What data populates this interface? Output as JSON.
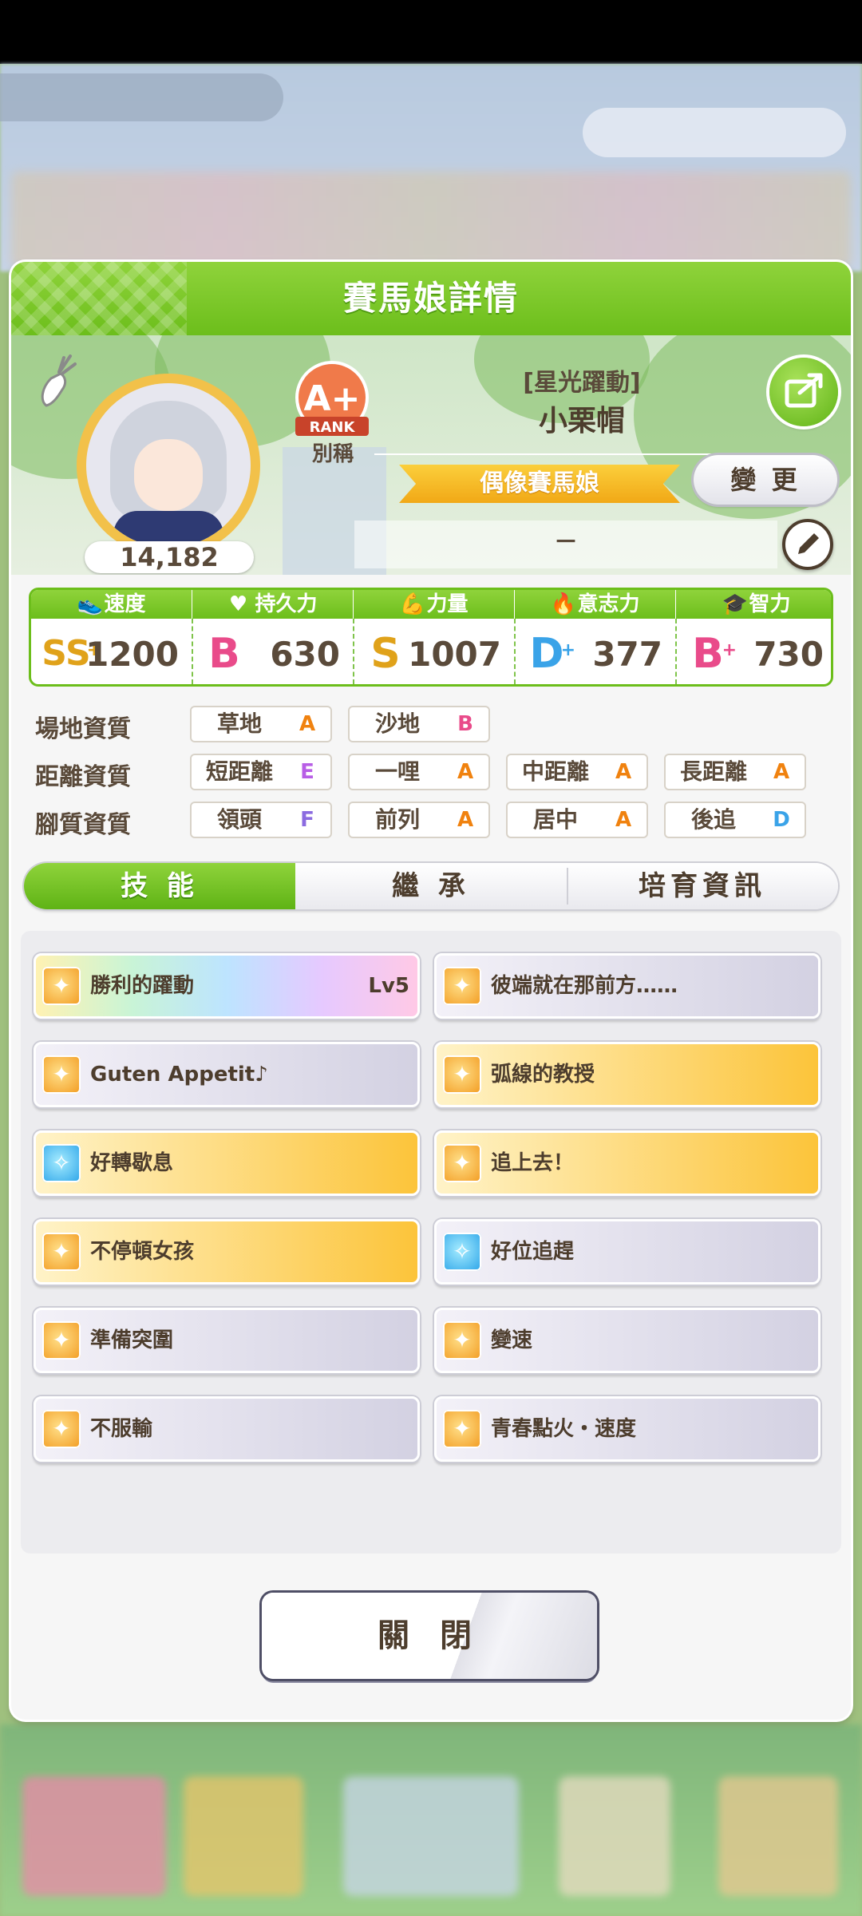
{
  "modal": {
    "title": "賽馬娘詳情"
  },
  "profile": {
    "fans": "14,182",
    "rank_grade": "A+",
    "rank_word": "RANK",
    "rank_caption": "別稱",
    "epithet": "[星光躍動]",
    "name": "小栗帽",
    "title_badge": "偶像賽馬娘",
    "change_label": "變 更",
    "memo": "－"
  },
  "stats": [
    {
      "label": "速度",
      "icon": "shoe-icon",
      "grade": "SS",
      "grade_plus": "+",
      "value": "1200",
      "color": "#e0a21a"
    },
    {
      "label": "持久力",
      "icon": "heart-icon",
      "grade": "B",
      "grade_plus": "",
      "value": "630",
      "color": "#e94b8a"
    },
    {
      "label": "力量",
      "icon": "muscle-icon",
      "grade": "S",
      "grade_plus": "",
      "value": "1007",
      "color": "#e0a21a"
    },
    {
      "label": "意志力",
      "icon": "flame-icon",
      "grade": "D",
      "grade_plus": "+",
      "value": "377",
      "color": "#3aa3e8"
    },
    {
      "label": "智力",
      "icon": "graduation-cap-icon",
      "grade": "B",
      "grade_plus": "+",
      "value": "730",
      "color": "#e94b8a"
    }
  ],
  "aptitude": {
    "track": {
      "label": "場地資質",
      "items": [
        {
          "name": "草地",
          "grade": "A"
        },
        {
          "name": "沙地",
          "grade": "B"
        }
      ]
    },
    "distance": {
      "label": "距離資質",
      "items": [
        {
          "name": "短距離",
          "grade": "E"
        },
        {
          "name": "一哩",
          "grade": "A"
        },
        {
          "name": "中距離",
          "grade": "A"
        },
        {
          "name": "長距離",
          "grade": "A"
        }
      ]
    },
    "style": {
      "label": "腳質資質",
      "items": [
        {
          "name": "領頭",
          "grade": "F"
        },
        {
          "name": "前列",
          "grade": "A"
        },
        {
          "name": "居中",
          "grade": "A"
        },
        {
          "name": "後追",
          "grade": "D"
        }
      ]
    }
  },
  "grade_colors": {
    "A": "#f0820f",
    "B": "#e94b8a",
    "D": "#3aa3e8",
    "E": "#b85ee6",
    "F": "#8b6be0"
  },
  "tabs": [
    {
      "label": "技 能",
      "active": true
    },
    {
      "label": "繼 承",
      "active": false
    },
    {
      "label": "培育資訊",
      "active": false
    }
  ],
  "skills": [
    {
      "name": "勝利的躍動",
      "level": "Lv5",
      "style": "rainbow",
      "icon": "orange"
    },
    {
      "name": "彼端就在那前方……",
      "level": "",
      "style": "normal",
      "icon": "orange"
    },
    {
      "name": "Guten Appetit♪",
      "level": "",
      "style": "normal",
      "icon": "orange"
    },
    {
      "name": "弧線的教授",
      "level": "",
      "style": "gold",
      "icon": "orange"
    },
    {
      "name": "好轉歇息",
      "level": "",
      "style": "gold",
      "icon": "blue"
    },
    {
      "name": "追上去！",
      "level": "",
      "style": "gold",
      "icon": "orange"
    },
    {
      "name": "不停頓女孩",
      "level": "",
      "style": "gold",
      "icon": "orange"
    },
    {
      "name": "好位追趕",
      "level": "",
      "style": "normal",
      "icon": "blue"
    },
    {
      "name": "準備突圍",
      "level": "",
      "style": "normal",
      "icon": "orange"
    },
    {
      "name": "變速",
      "level": "",
      "style": "normal",
      "icon": "orange"
    },
    {
      "name": "不服輸",
      "level": "",
      "style": "normal",
      "icon": "orange"
    },
    {
      "name": "青春點火・速度",
      "level": "",
      "style": "normal",
      "icon": "orange"
    }
  ],
  "close_label": "關 閉"
}
